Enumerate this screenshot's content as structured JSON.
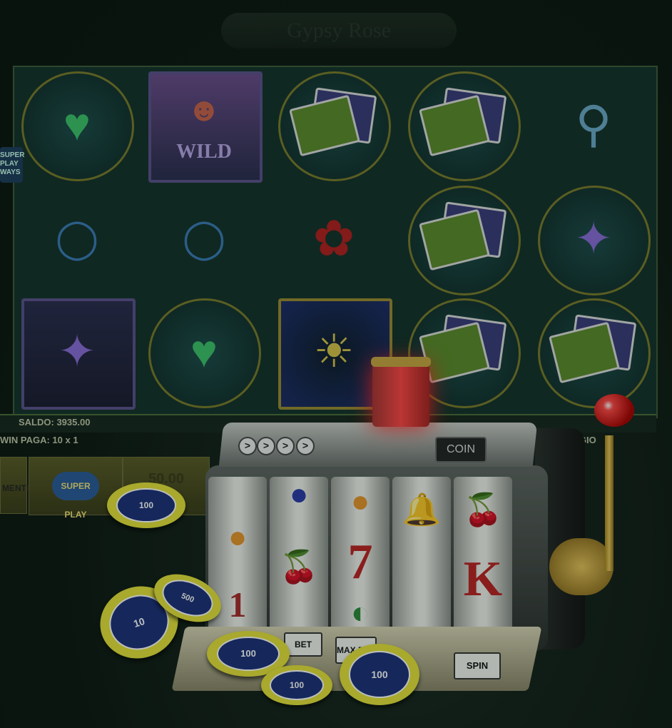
{
  "board": {
    "title": "Gypsy Rose",
    "side_badge": "SUPER PLAY WAYS",
    "saldo": "SALDO: 3935.00",
    "win_paga": "WIN PAGA: 10 x 1",
    "il_gioco": "IL GIO",
    "bottom_buttons": [
      {
        "label": "MENTI"
      },
      {
        "label": "SUPER PLAY"
      },
      {
        "label": "50.00"
      }
    ],
    "wild_label": "WILD",
    "reel_symbols": [
      [
        "heart-locket",
        "necklace",
        "tarot-book"
      ],
      [
        "wild-gypsy",
        "necklace",
        "heart-locket"
      ],
      [
        "tarot-cards",
        "red-rose",
        "zodiac-wheel"
      ],
      [
        "tarot-cards",
        "tarot-cards",
        "tarot-cards"
      ],
      [
        "magnifier",
        "tarot-book",
        "tarot-cards"
      ]
    ]
  },
  "machine": {
    "coin_label": "COIN",
    "arrow_buttons": [
      ">",
      ">",
      ">",
      ">"
    ],
    "reels": [
      {
        "symbols": [
          "",
          "orange",
          "1"
        ]
      },
      {
        "symbols": [
          "",
          "plum",
          "cherries"
        ]
      },
      {
        "symbols": [
          "orange",
          "7",
          "watermelon"
        ]
      },
      {
        "symbols": [
          "bell",
          "",
          ""
        ]
      },
      {
        "symbols": [
          "cherries",
          "K",
          ""
        ]
      }
    ],
    "panel_buttons": [
      {
        "label": "BET"
      },
      {
        "label": "MAX BET"
      },
      {
        "label": "SPIN"
      }
    ]
  },
  "chips": [
    {
      "value": "100"
    },
    {
      "value": "10"
    },
    {
      "value": "500"
    },
    {
      "value": "100"
    },
    {
      "value": "100"
    },
    {
      "value": "100"
    }
  ],
  "colors": {
    "chip_rim": "#e7e23a",
    "chip_center": "#1c2f7a",
    "light": "#ff3b3b",
    "lever": "#e7c25a"
  }
}
